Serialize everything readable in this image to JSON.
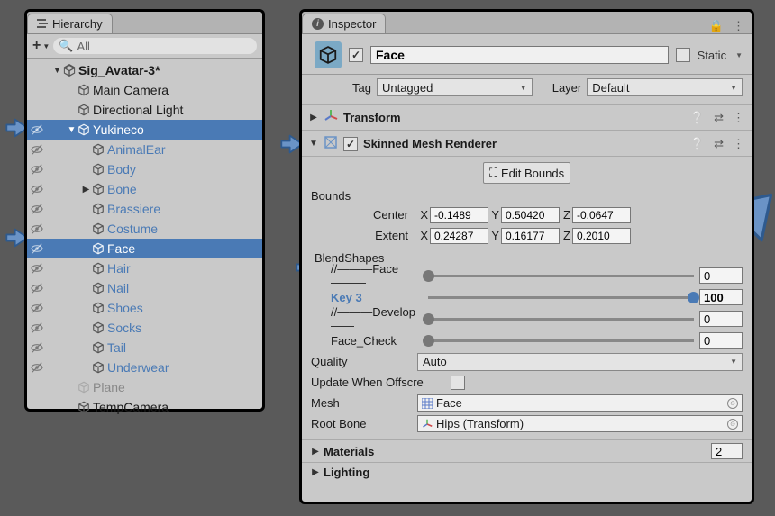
{
  "hierarchy": {
    "tab_label": "Hierarchy",
    "search_placeholder": "All",
    "scene": "Sig_Avatar-3*",
    "main_camera": "Main Camera",
    "directional_light": "Directional Light",
    "yukineco": "Yukineco",
    "children": {
      "animalEar": "AnimalEar",
      "body": "Body",
      "bone": "Bone",
      "brassiere": "Brassiere",
      "costume": "Costume",
      "face": "Face",
      "hair": "Hair",
      "nail": "Nail",
      "shoes": "Shoes",
      "socks": "Socks",
      "tail": "Tail",
      "underwear": "Underwear"
    },
    "plane": "Plane",
    "temp_camera": "TempCamera"
  },
  "inspector": {
    "tab_label": "Inspector",
    "object_name": "Face",
    "static_label": "Static",
    "tag_label": "Tag",
    "tag_value": "Untagged",
    "layer_label": "Layer",
    "layer_value": "Default",
    "transform_title": "Transform",
    "smr_title": "Skinned Mesh Renderer",
    "edit_bounds": "Edit Bounds",
    "bounds_label": "Bounds",
    "center_label": "Center",
    "center": {
      "x": "-0.1489",
      "y": "0.50420",
      "z": "-0.0647"
    },
    "extent_label": "Extent",
    "extent": {
      "x": "0.24287",
      "y": "0.16177",
      "z": "0.2010"
    },
    "blendshapes_label": "BlendShapes",
    "bs": [
      {
        "name": "//———Face———",
        "value": "0",
        "pct": 0
      },
      {
        "name": "Key 3",
        "value": "100",
        "pct": 100
      },
      {
        "name": "//———Develop——",
        "value": "0",
        "pct": 0
      },
      {
        "name": "Face_Check",
        "value": "0",
        "pct": 0
      }
    ],
    "quality_label": "Quality",
    "quality_value": "Auto",
    "update_offscreen_label": "Update When Offscre",
    "mesh_label": "Mesh",
    "mesh_value": "Face",
    "rootbone_label": "Root Bone",
    "rootbone_value": "Hips (Transform)",
    "materials_label": "Materials",
    "materials_count": "2",
    "lighting_label": "Lighting"
  }
}
